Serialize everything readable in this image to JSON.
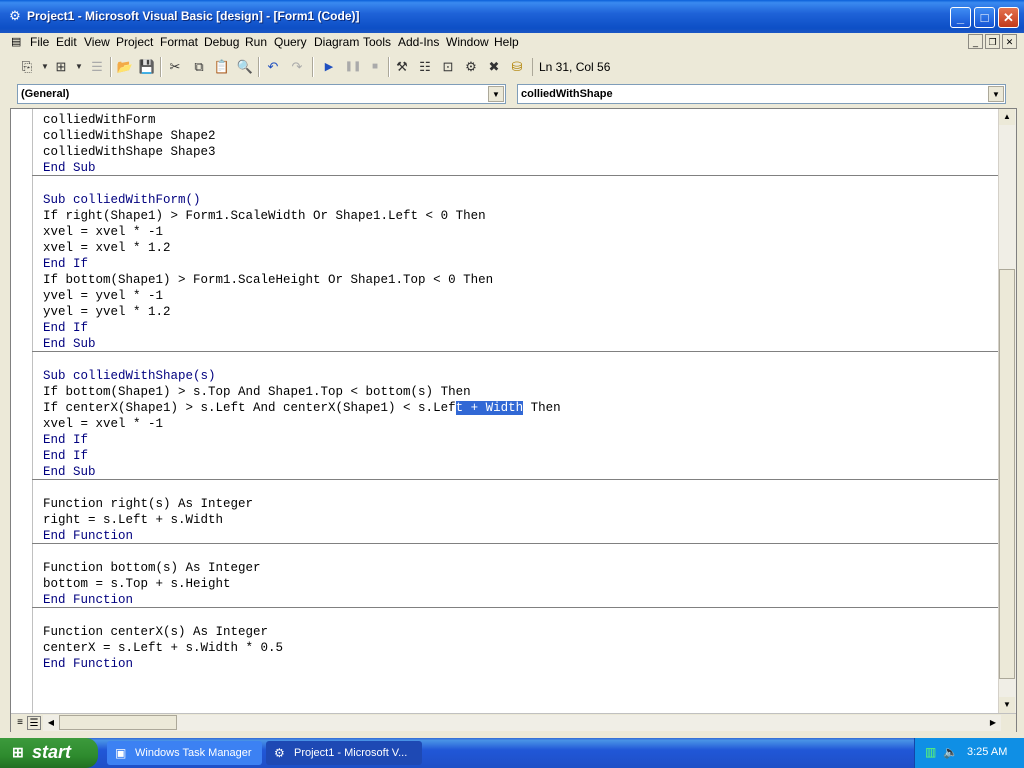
{
  "window": {
    "title": "Project1 - Microsoft Visual Basic [design] - [Form1 (Code)]",
    "app_icon": "vb-project-icon",
    "controls": {
      "minimize": "_",
      "maximize": "□",
      "close": "✕"
    }
  },
  "menu": {
    "items": [
      "File",
      "Edit",
      "View",
      "Project",
      "Format",
      "Debug",
      "Run",
      "Query",
      "Diagram",
      "Tools",
      "Add-Ins",
      "Window",
      "Help"
    ],
    "mdi_controls": {
      "minimize": "_",
      "restore": "❐",
      "close": "✕"
    }
  },
  "toolbar": {
    "cursor_position": "Ln 31, Col 56",
    "icons": [
      "add-project-icon",
      "add-form-icon",
      "menu-editor-icon",
      "open-project-icon",
      "save-project-icon",
      "cut-icon",
      "copy-icon",
      "paste-icon",
      "find-icon",
      "undo-icon",
      "redo-icon",
      "run-icon",
      "break-icon",
      "end-icon",
      "project-explorer-icon",
      "properties-window-icon",
      "form-layout-icon",
      "object-browser-icon",
      "toolbox-icon",
      "data-view-icon"
    ]
  },
  "combos": {
    "object": "(General)",
    "procedure": "colliedWithShape"
  },
  "code": {
    "lines": [
      "colliedWithForm",
      "colliedWithShape Shape2",
      "colliedWithShape Shape3",
      "End Sub",
      "",
      "Sub colliedWithForm()",
      "If right(Shape1) > Form1.ScaleWidth Or Shape1.Left < 0 Then",
      "xvel = xvel * -1",
      "xvel = xvel * 1.2",
      "End If",
      "If bottom(Shape1) > Form1.ScaleHeight Or Shape1.Top < 0 Then",
      "yvel = yvel * -1",
      "yvel = yvel * 1.2",
      "End If",
      "End Sub",
      "",
      "Sub colliedWithShape(s)",
      "If bottom(Shape1) > s.Top And Shape1.Top < bottom(s) Then",
      "If centerX(Shape1) > s.Left And centerX(Shape1) < s.Left + Width Then",
      "xvel = xvel * -1",
      "End If",
      "End If",
      "End Sub",
      "",
      "Function right(s) As Integer",
      "right = s.Left + s.Width",
      "End Function",
      "",
      "Function bottom(s) As Integer",
      "bottom = s.Top + s.Height",
      "End Function",
      "",
      "Function centerX(s) As Integer",
      "centerX = s.Left + s.Width * 0.5",
      "End Function"
    ],
    "selection": {
      "line": 18,
      "text": "t + Width"
    },
    "keyword_color": "#00007f",
    "selection_color": "#3168d5"
  },
  "taskbar": {
    "start_label": "start",
    "tasks": [
      {
        "label": "Windows Task Manager",
        "icon": "task-manager-icon"
      },
      {
        "label": "Project1 - Microsoft V...",
        "icon": "vb-project-icon"
      }
    ],
    "clock": "3:25 AM",
    "tray_icons": [
      "network-icon",
      "volume-icon"
    ]
  }
}
